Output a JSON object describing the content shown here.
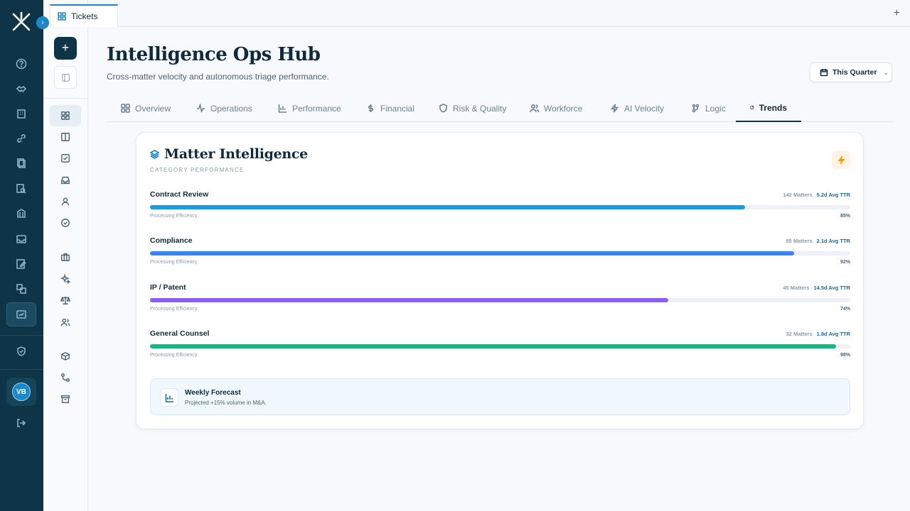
{
  "app": {
    "avatar_initials": "VB"
  },
  "tabstrip": {
    "tab_label": "Tickets",
    "new_tab_symbol": "+"
  },
  "sidebar": {
    "new_symbol": "+"
  },
  "header": {
    "title": "Intelligence Ops Hub",
    "subtitle": "Cross-matter velocity and autonomous triage performance.",
    "period_label": "This Quarter"
  },
  "nav": {
    "tabs": [
      {
        "label": "Overview",
        "icon": "grid-icon"
      },
      {
        "label": "Operations",
        "icon": "activity-icon"
      },
      {
        "label": "Performance",
        "icon": "bar-chart-icon"
      },
      {
        "label": "Financial",
        "icon": "dollar-icon"
      },
      {
        "label": "Risk & Quality",
        "icon": "shield-icon"
      },
      {
        "label": "Workforce",
        "icon": "users-icon"
      },
      {
        "label": "AI Velocity",
        "icon": "zap-icon"
      },
      {
        "label": "Logic",
        "icon": "logic-icon"
      },
      {
        "label": "Trends",
        "icon": "pie-chart-icon"
      }
    ],
    "active": "Trends"
  },
  "card": {
    "title": "Matter Intelligence",
    "subtitle": "CATEGORY PERFORMANCE",
    "categories": [
      {
        "name": "Contract Review",
        "matters": "142 Matters",
        "ttr": "5.2d Avg TTR",
        "efficiency_label": "Processing Efficiency",
        "pct_label": "85%",
        "value": 85,
        "color": "#1a9de0"
      },
      {
        "name": "Compliance",
        "matters": "85 Matters",
        "ttr": "2.1d Avg TTR",
        "efficiency_label": "Processing Efficiency",
        "pct_label": "92%",
        "value": 92,
        "color": "#3b82f6"
      },
      {
        "name": "IP / Patent",
        "matters": "45 Matters",
        "ttr": "14.5d Avg TTR",
        "efficiency_label": "Processing Efficiency",
        "pct_label": "74%",
        "value": 74,
        "color": "#8b5cf6"
      },
      {
        "name": "General Counsel",
        "matters": "32 Matters",
        "ttr": "1.8d Avg TTR",
        "efficiency_label": "Processing Efficiency",
        "pct_label": "98%",
        "value": 98,
        "color": "#10b981"
      }
    ],
    "forecast": {
      "title": "Weekly Forecast",
      "text": "Projected +15% volume in M&A."
    }
  }
}
